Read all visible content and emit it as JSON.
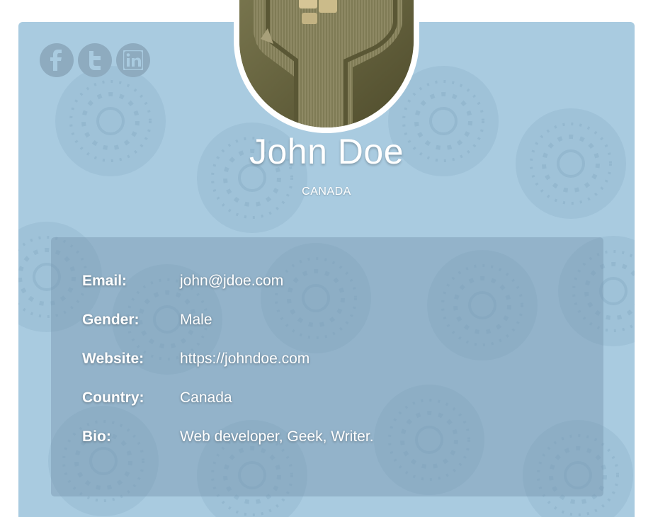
{
  "social": {
    "facebook_icon": "facebook-icon",
    "twitter_icon": "twitter-icon",
    "linkedin_icon": "linkedin-icon"
  },
  "profile": {
    "name": "John Doe",
    "country_caption": "CANADA"
  },
  "details": [
    {
      "label": "Email:",
      "value": "john@jdoe.com"
    },
    {
      "label": "Gender:",
      "value": "Male"
    },
    {
      "label": "Website:",
      "value": "https://johndoe.com"
    },
    {
      "label": "Country:",
      "value": "Canada"
    },
    {
      "label": "Bio:",
      "value": "Web developer, Geek, Writer."
    }
  ],
  "colors": {
    "card_background": "#a9cbe0",
    "social_button": "#8eabbf",
    "details_panel": "#7896af",
    "text": "#ffffff"
  }
}
